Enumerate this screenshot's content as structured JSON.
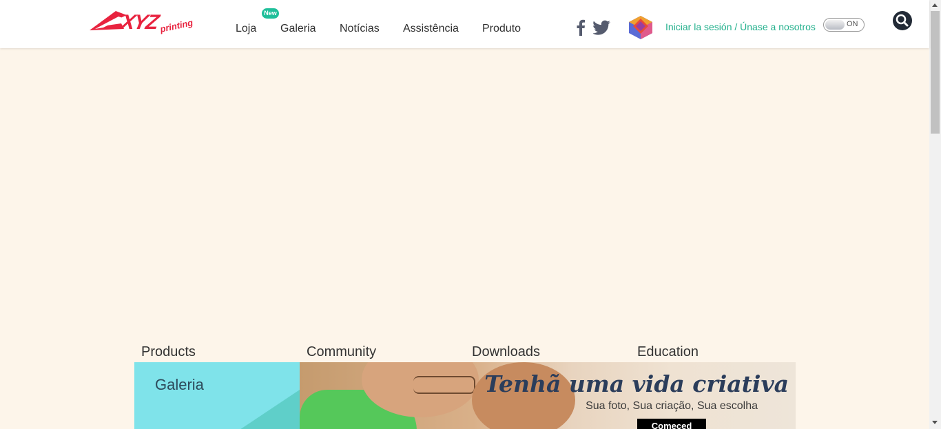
{
  "header": {
    "logo": {
      "text": "XYZ",
      "subtext": "printing"
    },
    "nav": [
      {
        "label": "Loja"
      },
      {
        "label": "Galeria"
      },
      {
        "label": "Notícias"
      },
      {
        "label": "Assistência"
      },
      {
        "label": "Produto"
      }
    ],
    "new_badge": "New",
    "social": [
      "facebook-icon",
      "twitter-icon"
    ],
    "login_link": "Iniciar la sesión / Únase a nosotros",
    "toggle_label": "ON"
  },
  "sections": [
    {
      "label": "Products"
    },
    {
      "label": "Community"
    },
    {
      "label": "Downloads"
    },
    {
      "label": "Education"
    }
  ],
  "banner": {
    "left_title": "Galeria",
    "headline": "Tenhã uma vida criativa",
    "subtitle": "Sua foto, Sua criação, Sua escolha",
    "cta": "Comeced"
  },
  "colors": {
    "brand_red": "#e8233f",
    "accent_green": "#22b08c",
    "page_bg": "#fdf5ea",
    "banner_cyan": "#7fe3ea"
  }
}
